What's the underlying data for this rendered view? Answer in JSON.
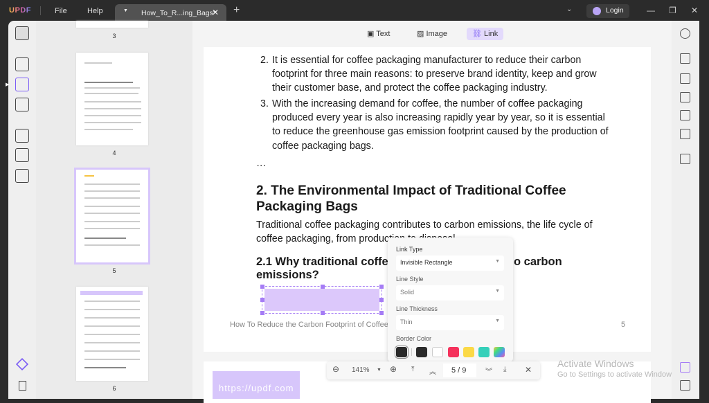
{
  "app": {
    "logo": "UPDF",
    "menu": [
      "File",
      "Help"
    ],
    "tab_title": "How_To_R...ing_Bags*",
    "login": "Login"
  },
  "toolbar": {
    "text": "Text",
    "image": "Image",
    "link": "Link"
  },
  "thumbnails": [
    {
      "label": "3"
    },
    {
      "label": "4"
    },
    {
      "label": "5"
    },
    {
      "label": "6"
    }
  ],
  "document": {
    "items": [
      {
        "num": "2.",
        "text": "It is essential for coffee packaging manufacturer to reduce their carbon footprint for three main reasons: to preserve brand identity, keep and grow their customer base, and protect the coffee packaging industry."
      },
      {
        "num": "3.",
        "text": "With the increasing demand for coffee, the number of coffee packaging produced every year is also increasing rapidly year by year, so it is essential to reduce the greenhouse gas emission footprint caused by the production of coffee packaging bags."
      }
    ],
    "ellipsis": "…",
    "heading": "2. The Environmental Impact of Traditional Coffee Packaging Bags",
    "paragraph": "Traditional coffee packaging contributes to carbon emissions, the life cycle of coffee packaging, from production to disposal.",
    "subheading_left": "2.1 Why traditional coffee",
    "subheading_right": "o carbon",
    "subheading_line2": "emissions?",
    "footer": "How To Reduce the Carbon Footprint of Coffee P",
    "page_number": "5",
    "next_page_watermark": "https://updf.com"
  },
  "link_popup": {
    "link_type_label": "Link Type",
    "link_type": "Invisible Rectangle",
    "line_style_label": "Line Style",
    "line_style": "Solid",
    "line_thickness_label": "Line Thickness",
    "line_thickness": "Thin",
    "border_color_label": "Border Color",
    "colors": [
      "#2b2b2b",
      "#2b2b2b",
      "#ffffff",
      "#f5325c",
      "#fbd946",
      "#35d0ba",
      "gradient"
    ]
  },
  "nav": {
    "zoom": "141%",
    "page": "5 / 9"
  },
  "watermark": {
    "title": "Activate Windows",
    "subtitle": "Go to Settings to activate Windows."
  }
}
